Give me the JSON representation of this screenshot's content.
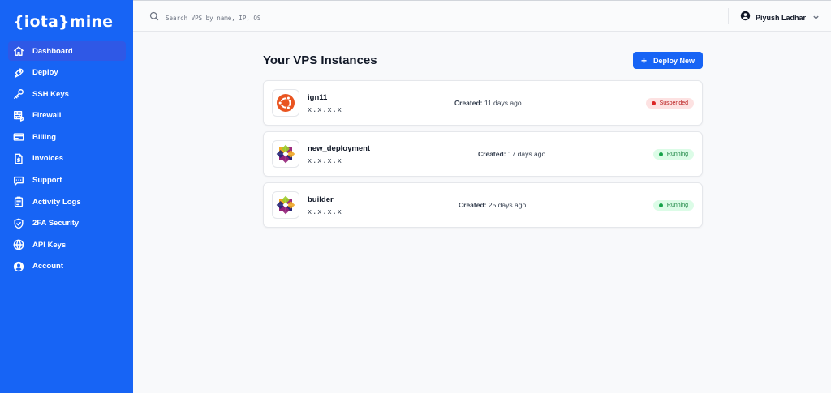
{
  "app": {
    "logo": "{iota}mine"
  },
  "sidebar": {
    "items": [
      {
        "label": "Dashboard",
        "icon": "home-icon",
        "active": true
      },
      {
        "label": "Deploy",
        "icon": "rocket-icon"
      },
      {
        "label": "SSH Keys",
        "icon": "key-icon"
      },
      {
        "label": "Firewall",
        "icon": "firewall-icon"
      },
      {
        "label": "Billing",
        "icon": "credit-card-icon"
      },
      {
        "label": "Invoices",
        "icon": "invoice-icon"
      },
      {
        "label": "Support",
        "icon": "chat-icon"
      },
      {
        "label": "Activity Logs",
        "icon": "clipboard-icon"
      },
      {
        "label": "2FA Security",
        "icon": "shield-icon"
      },
      {
        "label": "API Keys",
        "icon": "globe-icon"
      },
      {
        "label": "Account",
        "icon": "user-circle-icon"
      }
    ]
  },
  "header": {
    "search_placeholder": "Search VPS by name, IP, OS",
    "user_name": "Piyush Ladhar"
  },
  "main": {
    "title": "Your VPS Instances",
    "deploy_label": "Deploy New",
    "instances": [
      {
        "name": "ign11",
        "ip": "x.x.x.x",
        "created_label": "Created:",
        "created_value": "11 days ago",
        "status": "Suspended",
        "os_icon": "ubuntu-icon"
      },
      {
        "name": "new_deployment",
        "ip": "x.x.x.x",
        "created_label": "Created:",
        "created_value": "17 days ago",
        "status": "Running",
        "os_icon": "centos-icon"
      },
      {
        "name": "builder",
        "ip": "x.x.x.x",
        "created_label": "Created:",
        "created_value": "25 days ago",
        "status": "Running",
        "os_icon": "centos-icon"
      }
    ]
  },
  "colors": {
    "brand": "#1764f5",
    "suspended": "#dc2626",
    "running": "#16a34a"
  }
}
